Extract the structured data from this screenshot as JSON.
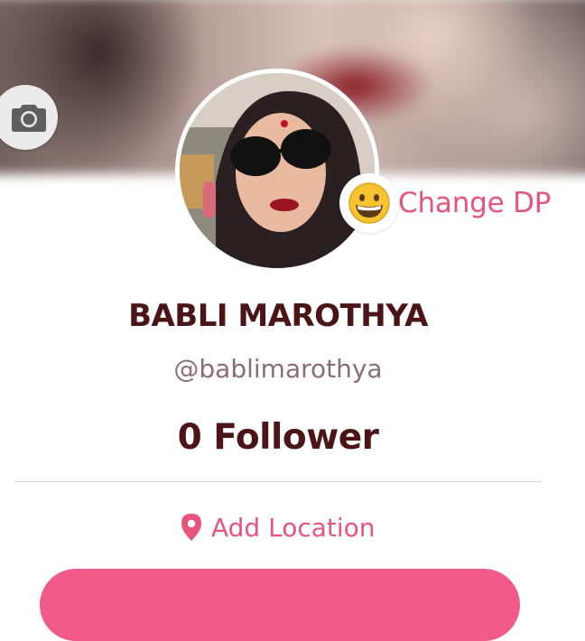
{
  "profile": {
    "name": "BABLI MAROTHYA",
    "username": "@bablimarothya",
    "followers_text": "0 Follower",
    "change_dp_label": "Change DP",
    "change_dp_emoji": "grinning-face-emoji",
    "location_label": "Add Location"
  },
  "icons": {
    "cover_camera": "camera-icon",
    "location": "map-pin-icon"
  },
  "colors": {
    "accent_pink": "#e8557c",
    "name_color": "#4b1518",
    "username_color": "#8a6e71",
    "button_pink": "#f25a8a"
  }
}
